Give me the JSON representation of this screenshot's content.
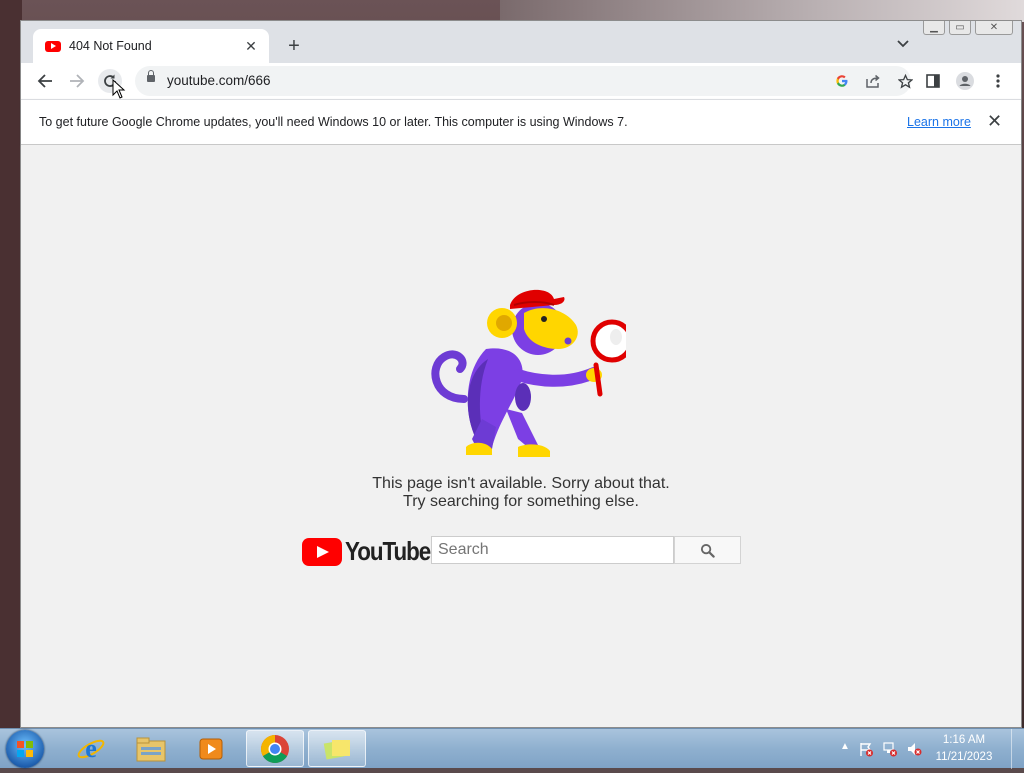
{
  "window": {
    "controls": {
      "minimize": "▁",
      "maximize": "▭",
      "close": "✕"
    }
  },
  "tab": {
    "title": "404 Not Found",
    "close": "✕",
    "new_tab": "+",
    "tab_search": "⌄"
  },
  "toolbar": {
    "url": "youtube.com/666",
    "icons": [
      "back-icon",
      "forward-icon",
      "reload-icon",
      "lock-icon",
      "google-icon",
      "share-icon",
      "bookmark-star-icon",
      "side-panel-icon",
      "profile-icon",
      "menu-icon"
    ]
  },
  "infobar": {
    "message": "To get future Google Chrome updates, you'll need Windows 10 or later. This computer is using Windows 7.",
    "link": "Learn more",
    "close": "✕"
  },
  "page": {
    "line1": "This page isn't available. Sorry about that.",
    "line2": "Try searching for something else.",
    "logo_text": "YouTube",
    "search_placeholder": "Search"
  },
  "taskbar": {
    "items": [
      "start-button",
      "internet-explorer",
      "windows-explorer",
      "media-player",
      "google-chrome",
      "sticky-notes"
    ],
    "time": "1:16 AM",
    "date": "11/21/2023"
  },
  "colors": {
    "youtube_red": "#ff0000",
    "monkey_purple": "#6d3bd4",
    "monkey_yellow": "#ffd600",
    "link_blue": "#1a73e8"
  }
}
